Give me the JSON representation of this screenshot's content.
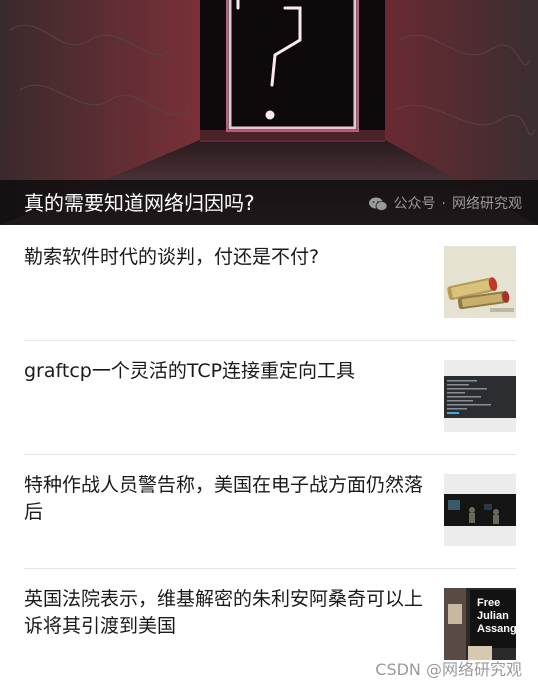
{
  "hero": {
    "title": "真的需要知道网络归因吗?",
    "source_prefix": "公众号",
    "source_sep": "·",
    "source_name": "网络研究观",
    "source_icon": "wechat-icon"
  },
  "articles": [
    {
      "title": "勒索软件时代的谈判，付还是不付?",
      "thumb_icon": "money-rolls-image"
    },
    {
      "title": "graftcp一个灵活的TCP连接重定向工具",
      "thumb_icon": "terminal-screenshot-image"
    },
    {
      "title": "特种作战人员警告称，美国在电子战方面仍然落后",
      "thumb_icon": "soldiers-dark-image"
    },
    {
      "title": "英国法院表示，维基解密的朱利安阿桑奇可以上诉将其引渡到美国",
      "thumb_icon": "free-assange-sign-image"
    }
  ],
  "thumb_text": {
    "line1": "Free",
    "line2": "Julian",
    "line3": "Assange"
  },
  "footer": {
    "watermark": "CSDN @网络研究观"
  }
}
